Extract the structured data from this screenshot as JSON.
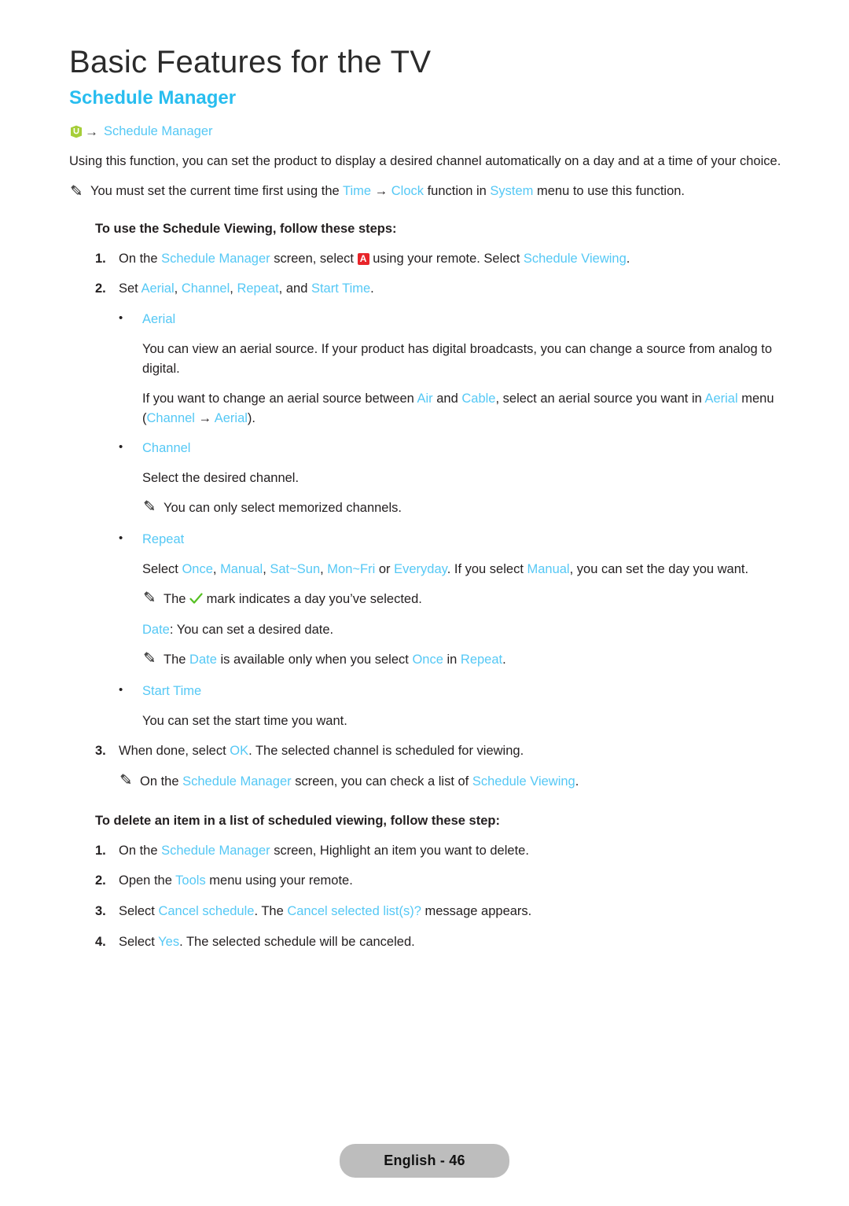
{
  "page": {
    "title": "Basic Features for the TV",
    "section_title": "Schedule Manager",
    "footer_label": "English - 46"
  },
  "colors": {
    "heading_blue": "#28bdef",
    "link_blue": "#55c8f5",
    "badge_red": "#e8252a",
    "check_green": "#55c022",
    "menu_icon_green": "#a6ce39",
    "footer_pill": "#bdbdbd",
    "body_text": "#231f20"
  },
  "breadcrumb": {
    "icon": "menu-cube-icon",
    "arrow": "→",
    "label": "Schedule Manager"
  },
  "intro": {
    "paragraph": "Using this function, you can set the product to display a desired channel automatically on a day and at a time of your choice."
  },
  "intro_note": {
    "icon": "pencil-icon",
    "parts": [
      {
        "t": "You must set the current time first using the ",
        "s": "plain"
      },
      {
        "t": "Time",
        "s": "blue"
      },
      {
        "t": " → ",
        "s": "plain"
      },
      {
        "t": "Clock",
        "s": "blue"
      },
      {
        "t": " function in ",
        "s": "plain"
      },
      {
        "t": "System",
        "s": "blue"
      },
      {
        "t": " menu to use this function.",
        "s": "plain"
      }
    ]
  },
  "schedule_viewing": {
    "heading": "To use the Schedule Viewing, follow these steps:",
    "step1": {
      "num": "1.",
      "parts": [
        {
          "t": "On the ",
          "s": "plain"
        },
        {
          "t": "Schedule Manager",
          "s": "blue"
        },
        {
          "t": " screen, select ",
          "s": "plain"
        },
        {
          "t": "A",
          "s": "badge"
        },
        {
          "t": " using your remote. Select ",
          "s": "plain"
        },
        {
          "t": "Schedule Viewing",
          "s": "blue"
        },
        {
          "t": ".",
          "s": "plain"
        }
      ]
    },
    "step2": {
      "num": "2.",
      "parts": [
        {
          "t": "Set ",
          "s": "plain"
        },
        {
          "t": "Aerial",
          "s": "blue"
        },
        {
          "t": ", ",
          "s": "plain"
        },
        {
          "t": "Channel",
          "s": "blue"
        },
        {
          "t": ", ",
          "s": "plain"
        },
        {
          "t": "Repeat",
          "s": "blue"
        },
        {
          "t": ", and ",
          "s": "plain"
        },
        {
          "t": "Start Time",
          "s": "blue"
        },
        {
          "t": ".",
          "s": "plain"
        }
      ]
    },
    "step3": {
      "num": "3.",
      "parts": [
        {
          "t": "When done, select ",
          "s": "plain"
        },
        {
          "t": "OK",
          "s": "blue"
        },
        {
          "t": ". The selected channel is scheduled for viewing.",
          "s": "plain"
        }
      ]
    },
    "step3_note": {
      "icon": "pencil-icon",
      "parts": [
        {
          "t": "On the ",
          "s": "plain"
        },
        {
          "t": "Schedule Manager",
          "s": "blue"
        },
        {
          "t": " screen, you can check a list of ",
          "s": "plain"
        },
        {
          "t": "Schedule Viewing",
          "s": "blue"
        },
        {
          "t": ".",
          "s": "plain"
        }
      ]
    },
    "bullets": {
      "aerial": {
        "dot": "•",
        "label": "Aerial",
        "para1": "You can view an aerial source. If your product has digital broadcasts, you can change a source from analog to digital.",
        "para2": [
          {
            "t": "If you want to change an aerial source between ",
            "s": "plain"
          },
          {
            "t": "Air",
            "s": "blue"
          },
          {
            "t": " and ",
            "s": "plain"
          },
          {
            "t": "Cable",
            "s": "blue"
          },
          {
            "t": ", select an aerial source you want in ",
            "s": "plain"
          },
          {
            "t": "Aerial",
            "s": "blue"
          },
          {
            "t": " menu (",
            "s": "plain"
          },
          {
            "t": "Channel",
            "s": "blue"
          },
          {
            "t": " → ",
            "s": "plain"
          },
          {
            "t": "Aerial",
            "s": "blue"
          },
          {
            "t": ").",
            "s": "plain"
          }
        ]
      },
      "channel": {
        "dot": "•",
        "label": "Channel",
        "para1": "Select the desired channel.",
        "note": {
          "icon": "pencil-icon",
          "parts": [
            {
              "t": "You can only select memorized channels.",
              "s": "plain"
            }
          ]
        }
      },
      "repeat": {
        "dot": "•",
        "label": "Repeat",
        "para1": [
          {
            "t": "Select ",
            "s": "plain"
          },
          {
            "t": "Once",
            "s": "blue"
          },
          {
            "t": ", ",
            "s": "plain"
          },
          {
            "t": "Manual",
            "s": "blue"
          },
          {
            "t": ", ",
            "s": "plain"
          },
          {
            "t": "Sat~Sun",
            "s": "blue"
          },
          {
            "t": ", ",
            "s": "plain"
          },
          {
            "t": "Mon~Fri",
            "s": "blue"
          },
          {
            "t": " or ",
            "s": "plain"
          },
          {
            "t": "Everyday",
            "s": "blue"
          },
          {
            "t": ". If you select ",
            "s": "plain"
          },
          {
            "t": "Manual",
            "s": "blue"
          },
          {
            "t": ", you can set the day you want.",
            "s": "plain"
          }
        ],
        "note1": {
          "icon": "pencil-icon",
          "parts": [
            {
              "t": "The ",
              "s": "plain"
            },
            {
              "t": "✓",
              "s": "check"
            },
            {
              "t": " mark indicates a day you’ve selected.",
              "s": "plain"
            }
          ]
        },
        "date_line": [
          {
            "t": "Date",
            "s": "blue"
          },
          {
            "t": ": You can set a desired date.",
            "s": "plain"
          }
        ],
        "note2": {
          "icon": "pencil-icon",
          "parts": [
            {
              "t": "The ",
              "s": "plain"
            },
            {
              "t": "Date",
              "s": "blue"
            },
            {
              "t": " is available only when you select ",
              "s": "plain"
            },
            {
              "t": "Once",
              "s": "blue"
            },
            {
              "t": " in ",
              "s": "plain"
            },
            {
              "t": "Repeat",
              "s": "blue"
            },
            {
              "t": ".",
              "s": "plain"
            }
          ]
        }
      },
      "start_time": {
        "dot": "•",
        "label": "Start Time",
        "para1": "You can set the start time you want."
      }
    }
  },
  "delete_item": {
    "heading": "To delete an item in a list of scheduled viewing, follow these step:",
    "step1": {
      "num": "1.",
      "parts": [
        {
          "t": "On the ",
          "s": "plain"
        },
        {
          "t": "Schedule Manager",
          "s": "blue"
        },
        {
          "t": " screen, Highlight an item you want to delete.",
          "s": "plain"
        }
      ]
    },
    "step2": {
      "num": "2.",
      "parts": [
        {
          "t": "Open the ",
          "s": "plain"
        },
        {
          "t": "Tools",
          "s": "blue"
        },
        {
          "t": " menu using your remote.",
          "s": "plain"
        }
      ]
    },
    "step3": {
      "num": "3.",
      "parts": [
        {
          "t": "Select ",
          "s": "plain"
        },
        {
          "t": "Cancel schedule",
          "s": "blue"
        },
        {
          "t": ". The ",
          "s": "plain"
        },
        {
          "t": "Cancel selected list(s)?",
          "s": "blue"
        },
        {
          "t": " message appears.",
          "s": "plain"
        }
      ]
    },
    "step4": {
      "num": "4.",
      "parts": [
        {
          "t": "Select ",
          "s": "plain"
        },
        {
          "t": "Yes",
          "s": "blue"
        },
        {
          "t": ". The selected schedule will be canceled.",
          "s": "plain"
        }
      ]
    }
  }
}
